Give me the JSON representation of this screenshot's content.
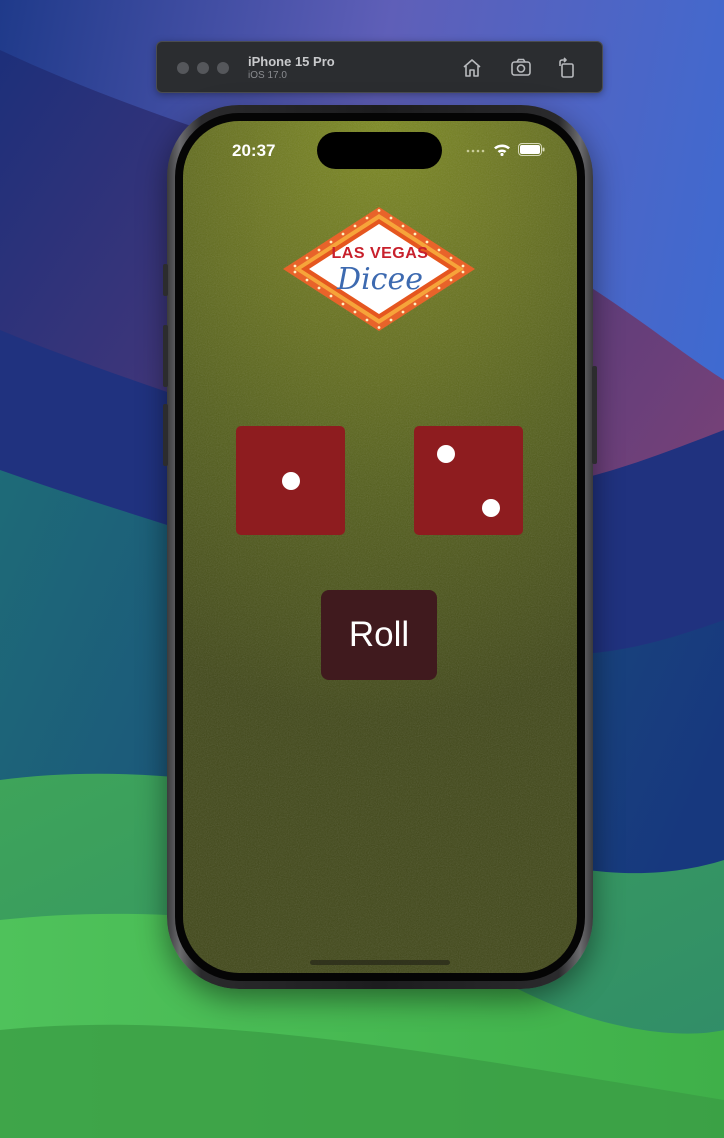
{
  "simulator": {
    "device_name": "iPhone 15 Pro",
    "os_version": "iOS 17.0",
    "icons": [
      "home-icon",
      "screenshot-icon",
      "rotate-icon"
    ]
  },
  "status_bar": {
    "time": "20:37",
    "icons": [
      "signal-dots-icon",
      "wifi-icon",
      "battery-icon"
    ]
  },
  "app": {
    "logo": {
      "line1": "LAS VEGAS",
      "line2": "Dicee"
    },
    "dice": [
      {
        "face": 1
      },
      {
        "face": 2
      }
    ],
    "roll_button_label": "Roll"
  },
  "colors": {
    "felt": "#6b7520",
    "die": "#8e1c1f",
    "roll_button": "#401a1e",
    "logo_red": "#c8202c",
    "logo_blue": "#3d6ab0"
  }
}
